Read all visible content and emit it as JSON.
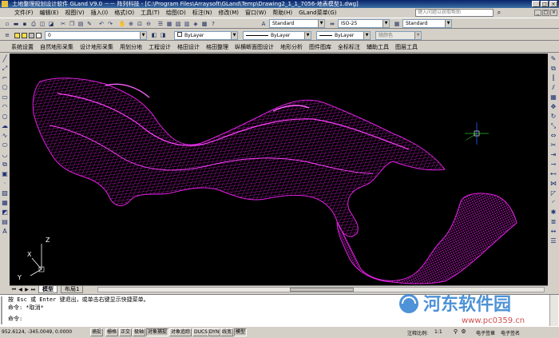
{
  "window": {
    "title": "土地整理规划设计软件 GLand V9.0 －－ 阵列科技 - [C:\\Program Files\\Arraysoft\\GLand\\Temp\\Drawing2_1_1_7056-地表模型1.dwg]",
    "controls": [
      "_",
      "□",
      "×"
    ]
  },
  "menubar": {
    "items": [
      "文件(F)",
      "编辑(E)",
      "视图(V)",
      "插入(I)",
      "格式(O)",
      "工具(T)",
      "绘图(D)",
      "标注(N)",
      "修改(M)",
      "窗口(W)",
      "帮助(H)",
      "GLand菜单(G)"
    ],
    "help_placeholder": "键入问题以获取帮助",
    "doc_controls": [
      "_",
      "□",
      "×"
    ]
  },
  "toolbar1": {
    "text_style": "Standard",
    "dim_style": "ISO-25",
    "table_style": "Standard"
  },
  "toolbar2": {
    "layer_value": "0",
    "color_value": "ByLayer",
    "linetype_value": "ByLayer",
    "lineweight_value": "ByLayer",
    "plotstyle_value": "随颜色"
  },
  "gland_menu": {
    "items": [
      "系统设置",
      "自然地形采集",
      "设计地形采集",
      "用划分地",
      "工程设计",
      "格田设计",
      "格田整理",
      "纵横断面图设计",
      "地形分析",
      "图件图库",
      "全标标注",
      "辅助工具",
      "图层工具"
    ]
  },
  "ucs": {
    "x_label": "X",
    "y_label": "Y",
    "z_label": "Z"
  },
  "tabs": {
    "items": [
      "模型",
      "布局1"
    ],
    "active": 0
  },
  "command": {
    "lines": [
      "按 Esc 或 Enter 键退出，或单击右键显示快捷菜单。",
      "命令: *取消*",
      "命令:"
    ]
  },
  "status": {
    "coordinates": "952.6124,  -345.0049, 0.0000",
    "toggles": [
      {
        "label": "捕捉",
        "on": false
      },
      {
        "label": "栅格",
        "on": false
      },
      {
        "label": "正交",
        "on": false
      },
      {
        "label": "极轴",
        "on": false
      },
      {
        "label": "对象捕捉",
        "on": true
      },
      {
        "label": "对象追踪",
        "on": false
      },
      {
        "label": "DUCS",
        "on": false
      },
      {
        "label": "DYN",
        "on": false
      },
      {
        "label": "线宽",
        "on": false
      },
      {
        "label": "模型",
        "on": true
      }
    ],
    "annotation_scale_label": "注释比例:",
    "annotation_scale_value": "1:1",
    "e_seal": "电子签章",
    "e_sign": "电子签名"
  },
  "watermark": {
    "brand": "河东软件园",
    "url": "www.pc0359.cn"
  },
  "colors": {
    "canvas_bg": "#000000",
    "terrain_mesh": "#e020e0",
    "ui_face": "#d4d0c8",
    "title_bar": "#0a246a"
  }
}
